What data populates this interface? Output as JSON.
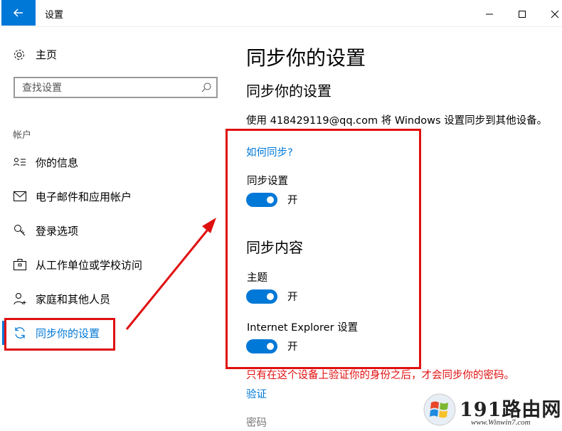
{
  "window": {
    "title": "设置",
    "controls": {
      "minimize": "—",
      "maximize": "☐",
      "close": "✕"
    }
  },
  "sidebar": {
    "home_label": "主页",
    "search_placeholder": "查找设置",
    "section_label": "帐户",
    "items": [
      {
        "label": "你的信息",
        "icon": "person-card-icon"
      },
      {
        "label": "电子邮件和应用帐户",
        "icon": "mail-icon"
      },
      {
        "label": "登录选项",
        "icon": "key-icon"
      },
      {
        "label": "从工作单位或学校访问",
        "icon": "briefcase-icon"
      },
      {
        "label": "家庭和其他人员",
        "icon": "person-add-icon"
      },
      {
        "label": "同步你的设置",
        "icon": "sync-icon",
        "active": true
      }
    ]
  },
  "content": {
    "page_title": "同步你的设置",
    "sub_title": "同步你的设置",
    "description": "使用 418429119@qq.com 将 Windows 设置同步到其他设备。",
    "how_sync_link": "如何同步?",
    "sync_settings_label": "同步设置",
    "sync_settings_state": "开",
    "sync_content_title": "同步内容",
    "theme_label": "主题",
    "theme_state": "开",
    "ie_label": "Internet Explorer 设置",
    "ie_state": "开",
    "warning": "只有在这个设备上验证你的身份之后，才会同步你的密码。",
    "verify_link": "验证",
    "password_label": "密码"
  },
  "watermark": {
    "text": "191路由网",
    "url": "www.Winwin7.com"
  },
  "colors": {
    "accent": "#0078d7",
    "highlight": "#e01010"
  }
}
